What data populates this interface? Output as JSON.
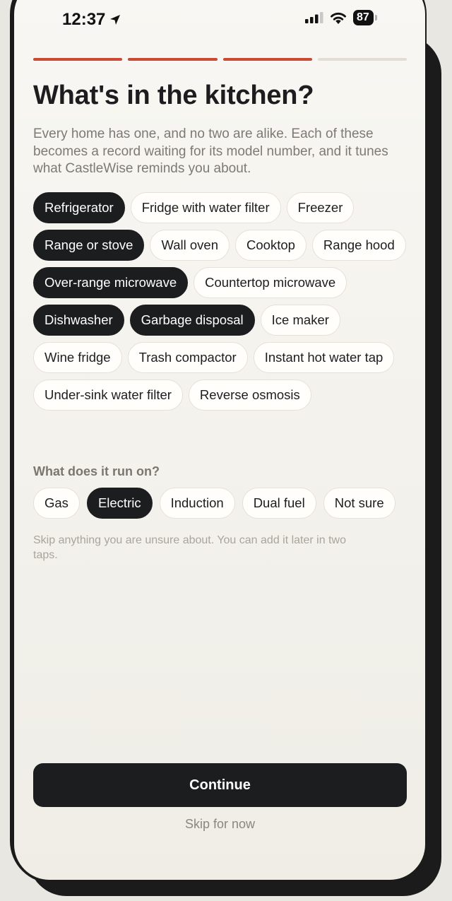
{
  "status_bar": {
    "time": "12:37",
    "battery": "87",
    "icons": [
      "location-arrow-icon",
      "cellular-signal-icon",
      "wifi-icon",
      "battery-icon"
    ]
  },
  "progress": {
    "total_steps": 4,
    "completed_steps": 3
  },
  "header": {
    "title": "What's in the kitchen?",
    "subtitle": "Every home has one, and no two are alike. Each of these becomes a record waiting for its model number, and it tunes what CastleWise reminds you about."
  },
  "appliances": [
    {
      "label": "Refrigerator",
      "selected": true
    },
    {
      "label": "Fridge with water filter",
      "selected": false
    },
    {
      "label": "Freezer",
      "selected": false
    },
    {
      "label": "Range or stove",
      "selected": true
    },
    {
      "label": "Wall oven",
      "selected": false
    },
    {
      "label": "Cooktop",
      "selected": false
    },
    {
      "label": "Range hood",
      "selected": false
    },
    {
      "label": "Over-range microwave",
      "selected": true
    },
    {
      "label": "Countertop microwave",
      "selected": false
    },
    {
      "label": "Dishwasher",
      "selected": true
    },
    {
      "label": "Garbage disposal",
      "selected": true
    },
    {
      "label": "Ice maker",
      "selected": false
    },
    {
      "label": "Wine fridge",
      "selected": false
    },
    {
      "label": "Trash compactor",
      "selected": false
    },
    {
      "label": "Instant hot water tap",
      "selected": false
    },
    {
      "label": "Under-sink water filter",
      "selected": false
    },
    {
      "label": "Reverse osmosis",
      "selected": false
    }
  ],
  "fuel": {
    "label": "What does it run on?",
    "options": [
      {
        "label": "Gas",
        "selected": false
      },
      {
        "label": "Electric",
        "selected": true
      },
      {
        "label": "Induction",
        "selected": false
      },
      {
        "label": "Dual fuel",
        "selected": false
      },
      {
        "label": "Not sure",
        "selected": false
      }
    ]
  },
  "hint": "Skip anything you are unsure about. You can add it later in two taps.",
  "actions": {
    "continue_label": "Continue",
    "skip_label": "Skip for now"
  },
  "colors": {
    "accent": "#cc4a33",
    "selected_chip": "#1c1d1f",
    "background": "#f5f3ee"
  }
}
